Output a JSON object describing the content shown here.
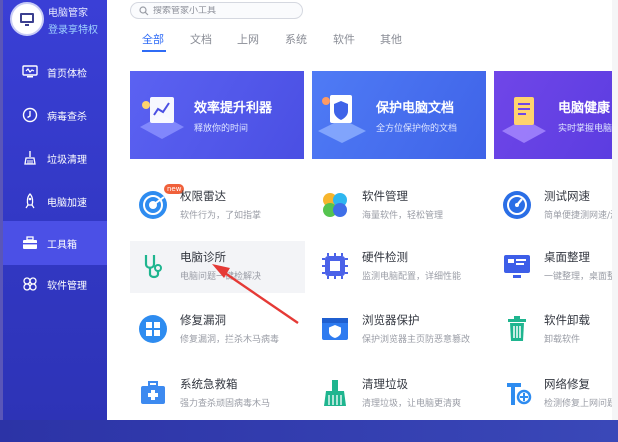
{
  "sidebar": {
    "title": "电脑管家",
    "login": "登录享特权",
    "items": [
      {
        "label": "首页体检",
        "icon": "monitor-check-icon"
      },
      {
        "label": "病毒查杀",
        "icon": "shield-scan-icon"
      },
      {
        "label": "垃圾清理",
        "icon": "broom-icon"
      },
      {
        "label": "电脑加速",
        "icon": "rocket-icon"
      },
      {
        "label": "工具箱",
        "icon": "toolbox-icon",
        "active": true
      },
      {
        "label": "软件管理",
        "icon": "apps-icon"
      }
    ]
  },
  "search": {
    "placeholder": "搜索管家小工具"
  },
  "tabs": [
    {
      "label": "全部",
      "active": true
    },
    {
      "label": "文档"
    },
    {
      "label": "上网"
    },
    {
      "label": "系统"
    },
    {
      "label": "软件"
    },
    {
      "label": "其他"
    }
  ],
  "banners": [
    {
      "title": "效率提升利器",
      "subtitle": "释放你的时间"
    },
    {
      "title": "保护电脑文档",
      "subtitle": "全方位保护你的文档"
    },
    {
      "title": "电脑健康",
      "subtitle": "实时掌握电脑状"
    }
  ],
  "tools": [
    {
      "name": "权限雷达",
      "desc": "软件行为，了如指掌",
      "icon": "radar-icon",
      "badge": "new"
    },
    {
      "name": "软件管理",
      "desc": "海量软件，轻松管理",
      "icon": "software-manager-icon"
    },
    {
      "name": "测试网速",
      "desc": "简单便捷测网速/测",
      "icon": "speedometer-icon"
    },
    {
      "name": "电脑诊所",
      "desc": "电脑问题一键检解决",
      "icon": "stethoscope-icon",
      "hover": true
    },
    {
      "name": "硬件检测",
      "desc": "监测电脑配置，详细性能",
      "icon": "chip-icon"
    },
    {
      "name": "桌面整理",
      "desc": "一键整理，桌面整",
      "icon": "desktop-organize-icon"
    },
    {
      "name": "修复漏洞",
      "desc": "修复漏洞，拦杀木马病毒",
      "icon": "windows-repair-icon"
    },
    {
      "name": "浏览器保护",
      "desc": "保护浏览器主页防恶意篡改",
      "icon": "browser-shield-icon"
    },
    {
      "name": "软件卸载",
      "desc": "卸载软件",
      "icon": "trash-icon"
    },
    {
      "name": "系统急救箱",
      "desc": "强力查杀顽固病毒木马",
      "icon": "first-aid-icon"
    },
    {
      "name": "清理垃圾",
      "desc": "清理垃圾，让电脑更清爽",
      "icon": "clean-brush-icon"
    },
    {
      "name": "网络修复",
      "desc": "检测修复上网问题",
      "icon": "network-repair-icon"
    }
  ],
  "colors": {
    "sidebar": "#3238c4",
    "accent": "#2f6cf6",
    "arrow": "#e53a36"
  }
}
